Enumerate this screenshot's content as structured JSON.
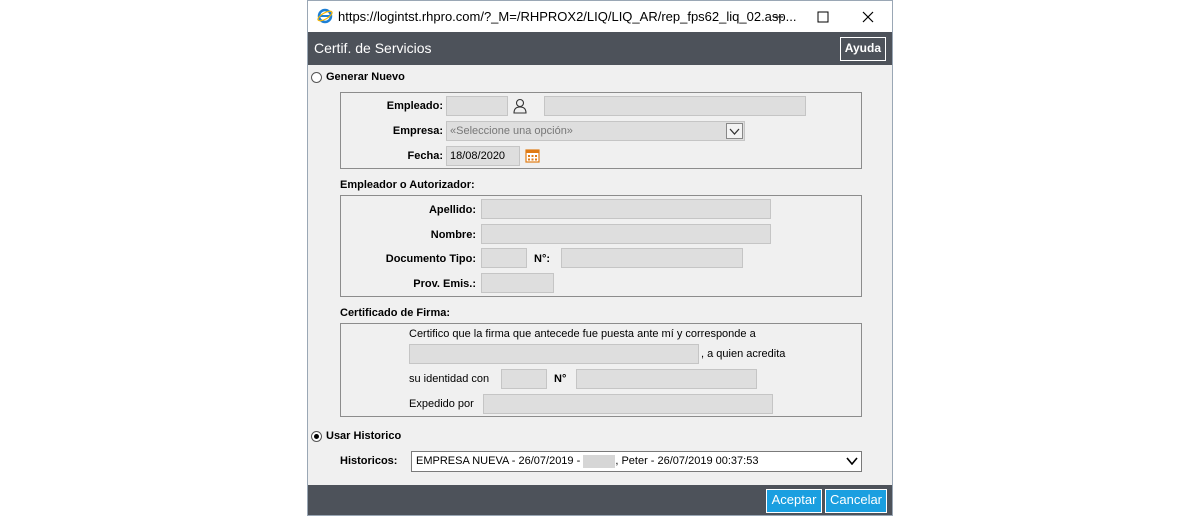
{
  "window": {
    "url": "https://logintst.rhpro.com/?_M=/RHPROX2/LIQ/LIQ_AR/rep_fps62_liq_02.asp...",
    "header_title": "Certif. de Servicios",
    "help_label": "Ayuda"
  },
  "generar": {
    "label": "Generar Nuevo",
    "empleado_label": "Empleado:",
    "empresa_label": "Empresa:",
    "empresa_placeholder": "«Seleccione una opción»",
    "fecha_label": "Fecha:",
    "fecha_value": "18/08/2020"
  },
  "empleador": {
    "title": "Empleador o Autorizador:",
    "apellido_label": "Apellido:",
    "nombre_label": "Nombre:",
    "doc_tipo_label": "Documento Tipo:",
    "nro_label": "N°:",
    "prov_label": "Prov. Emis.:"
  },
  "firma": {
    "title": "Certificado de Firma:",
    "line1": "Certifico que la firma que antecede fue puesta ante mí y corresponde a",
    "line2": ", a quien acredita",
    "line3": "su identidad con",
    "nro_label": "N°",
    "line4": "Expedido por"
  },
  "historico": {
    "label": "Usar Historico",
    "historicos_label": "Historicos:",
    "selected_part1": "EMPRESA NUEVA - 26/07/2019 -",
    "selected_part2": ", Peter - 26/07/2019 00:37:53"
  },
  "footer": {
    "accept_label": "Aceptar",
    "cancel_label": "Cancelar"
  },
  "colors": {
    "header_bg": "#4d525a",
    "button_blue": "#1a9fe0",
    "calendar_orange": "#e07b14"
  }
}
